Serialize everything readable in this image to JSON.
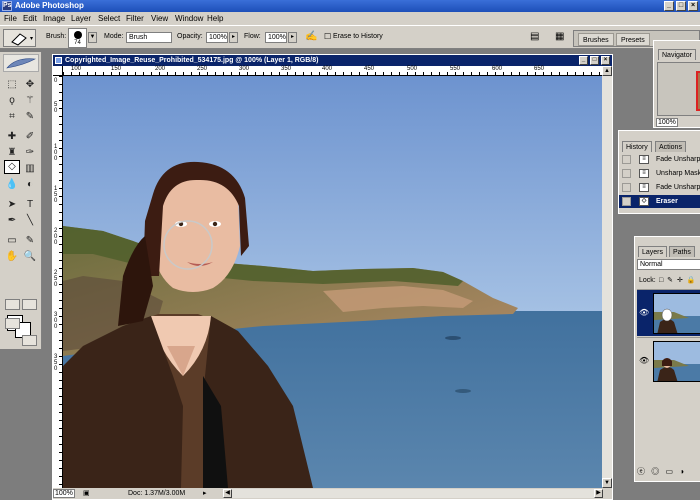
{
  "app": {
    "title": "Adobe Photoshop",
    "icon_label": "Ps",
    "window_buttons": [
      "_",
      "□",
      "×"
    ]
  },
  "menu": [
    "File",
    "Edit",
    "Image",
    "Layer",
    "Select",
    "Filter",
    "View",
    "Window",
    "Help"
  ],
  "options": {
    "brush_label": "Brush:",
    "brush_size": "74",
    "mode_label": "Mode:",
    "mode_value": "Brush",
    "opacity_label": "Opacity:",
    "opacity_value": "100%",
    "flow_label": "Flow:",
    "flow_value": "100%",
    "erase_to_history_label": "Erase to History",
    "erase_to_history_checked": false,
    "palette_tabs": [
      "Brushes",
      "Presets"
    ]
  },
  "document": {
    "title": "Copyrighted_Image_Reuse_Prohibited_534175.jpg @ 100% (Layer 1, RGB/8)",
    "ruler_h": [
      "100",
      "150",
      "200",
      "250",
      "300",
      "350",
      "400",
      "450",
      "500",
      "550",
      "600",
      "650"
    ],
    "ruler_v": [
      "0",
      "5",
      "0",
      "1",
      "0",
      "0",
      "1",
      "5",
      "0",
      "2",
      "0",
      "0",
      "2",
      "5",
      "0",
      "3",
      "0",
      "0",
      "3",
      "5",
      "0"
    ],
    "zoom": "100%",
    "doc_size": "Doc: 1.37M/3.00M"
  },
  "navigator": {
    "title": "Navigator",
    "zoom": "100%"
  },
  "history": {
    "tabs": [
      "History",
      "Actions"
    ],
    "items": [
      {
        "label": "Fade Unsharp"
      },
      {
        "label": "Unsharp Mask"
      },
      {
        "label": "Fade Unsharp"
      },
      {
        "label": "Eraser",
        "selected": true
      }
    ]
  },
  "layers": {
    "tabs": [
      "Layers",
      "Paths"
    ],
    "blend_mode": "Normal",
    "lock_label": "Lock:",
    "lock_icons": "□ ✎ ✛ 🔒"
  },
  "colors": {
    "titlebar": "#1d4fb8",
    "selection": "#0a246a",
    "chrome": "#d4d0c8",
    "workspace": "#7d7d7d"
  }
}
